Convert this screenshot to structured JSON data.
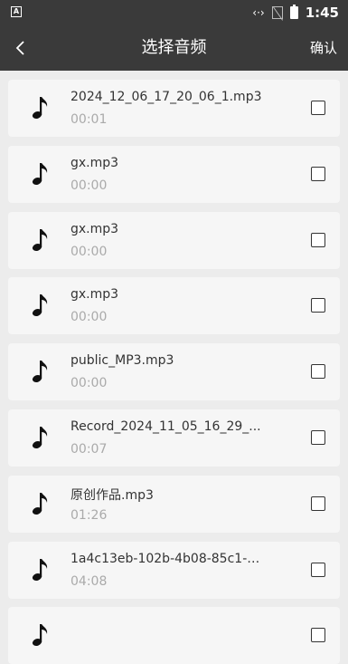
{
  "status_bar": {
    "app_badge": "A",
    "time": "1:45",
    "code_glyph": "‹·›"
  },
  "header": {
    "title": "选择音频",
    "confirm_label": "确认"
  },
  "audio_files": [
    {
      "name": "2024_12_06_17_20_06_1.mp3",
      "duration": "00:01"
    },
    {
      "name": "gx.mp3",
      "duration": "00:00"
    },
    {
      "name": "gx.mp3",
      "duration": "00:00"
    },
    {
      "name": "gx.mp3",
      "duration": "00:00"
    },
    {
      "name": "public_MP3.mp3",
      "duration": "00:00"
    },
    {
      "name": "Record_2024_11_05_16_29_...",
      "duration": "00:07"
    },
    {
      "name": "原创作品.mp3",
      "duration": "01:26"
    },
    {
      "name": "1a4c13eb-102b-4b08-85c1-8...",
      "duration": "04:08"
    },
    {
      "name": "",
      "duration": ""
    }
  ],
  "colors": {
    "bar": "#3a3a3a",
    "background": "#ececec",
    "card": "#f6f6f6"
  },
  "icons": {
    "back": "chevron-left-icon",
    "file": "music-note-icon",
    "select": "checkbox-icon"
  }
}
